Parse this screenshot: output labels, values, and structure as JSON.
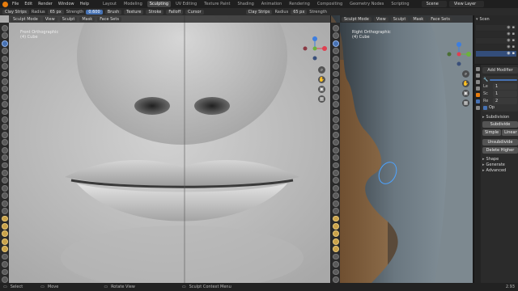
{
  "topbar": {
    "menus": [
      "File",
      "Edit",
      "Render",
      "Window",
      "Help"
    ],
    "workspaces": [
      "Layout",
      "Modeling",
      "Sculpting",
      "UV Editing",
      "Texture Paint",
      "Shading",
      "Animation",
      "Rendering",
      "Compositing",
      "Geometry Nodes",
      "Scripting"
    ],
    "active_workspace": "Sculpting",
    "scene": "Scene",
    "view_layer": "View Layer"
  },
  "toolheader": {
    "brush": "Clay Strips",
    "radius_label": "Radius",
    "radius_value": "65 px",
    "strength_label": "Strength",
    "strength_value": "0.600",
    "menus": [
      "Brush",
      "Texture",
      "Stroke",
      "Falloff",
      "Cursor"
    ],
    "right_brush": "Clay Strips",
    "right_radius_label": "Radius",
    "right_radius_value": "65 px",
    "right_strength_label": "Strength"
  },
  "left_viewport": {
    "mode": "Sculpt Mode",
    "menus": [
      "View",
      "Sculpt",
      "Mask",
      "Face Sets"
    ],
    "info_line1": "Front Orthographic",
    "info_line2": "(4) Cube"
  },
  "right_viewport": {
    "mode": "Sculpt Mode",
    "menus": [
      "View",
      "Sculpt",
      "Mask",
      "Face Sets"
    ],
    "info_line1": "Right Orthographic",
    "info_line2": "(4) Cube"
  },
  "outliner": {
    "title": "Scen"
  },
  "properties": {
    "add_modifier": "Add Modifier",
    "rows": [
      "Le",
      "Sc",
      "Re"
    ],
    "row_values": [
      "1",
      "1",
      "2"
    ],
    "subdivision": "Subdivision",
    "subdivide": "Subdivide",
    "simple": "Simple",
    "linear": "Linear",
    "unsubdivide": "Unsubdivide",
    "delete_higher": "Delete Higher",
    "shape": "Shape",
    "generate": "Generate",
    "advanced": "Advanced",
    "op": "Op"
  },
  "statusbar": {
    "select": "Select",
    "move": "Move",
    "rotate": "Rotate View",
    "context": "Sculpt Context Menu",
    "version": "2.93"
  },
  "colors": {
    "accent": "#4772b3",
    "logo": "#e87d0d",
    "gizmo_x": "#e04050",
    "gizmo_y": "#6cb23c",
    "gizmo_z": "#3d7ee0"
  }
}
